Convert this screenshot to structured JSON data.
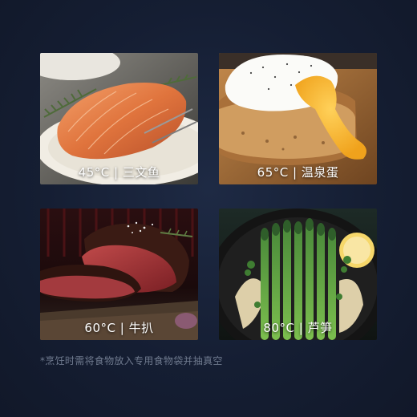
{
  "colors": {
    "background": "#151e33",
    "caption_text": "#ffffff",
    "footnote_text": "#6f7a8e"
  },
  "items": [
    {
      "caption": "45°C | 三文鱼"
    },
    {
      "caption": "65°C | 温泉蛋"
    },
    {
      "caption": "60°C | 牛扒"
    },
    {
      "caption": "80°C | 芦笋"
    }
  ],
  "footnote": "*烹饪时需将食物放入专用食物袋并抽真空"
}
